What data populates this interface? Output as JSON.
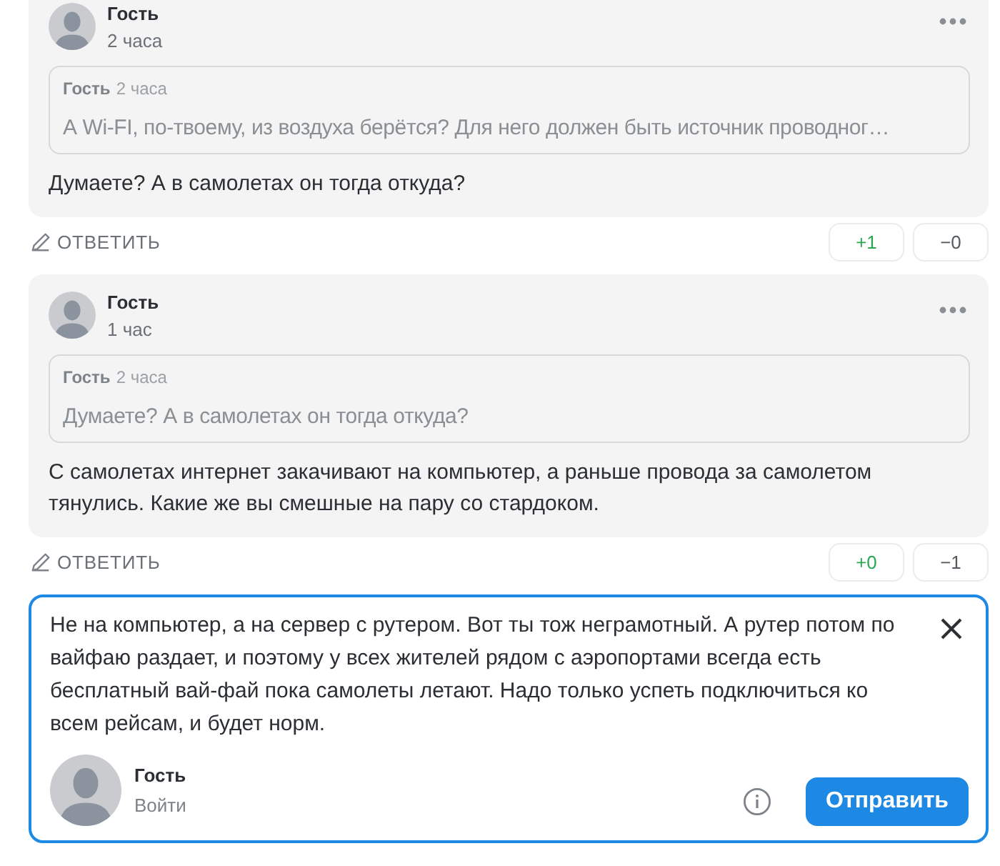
{
  "comments": [
    {
      "author": "Гость",
      "time": "2 часа",
      "quote": {
        "author": "Гость",
        "time": "2 часа",
        "text": "А Wi-FI, по-твоему, из воздуха берётся? Для него должен быть источник проводног…"
      },
      "text": "Думаете? А в самолетах он тогда откуда?",
      "reply": "ОТВЕТИТЬ",
      "upvotes": "+1",
      "downvotes": "−0"
    },
    {
      "author": "Гость",
      "time": "1 час",
      "quote": {
        "author": "Гость",
        "time": "2 часа",
        "text": "Думаете? А в самолетах он тогда откуда?"
      },
      "text": "С самолетах интернет закачивают на компьютер, а раньше провода за самолетом тянулись. Какие же вы смешные на пару со стардоком.",
      "reply": "ОТВЕТИТЬ",
      "upvotes": "+0",
      "downvotes": "−1"
    }
  ],
  "composer": {
    "value": "Не на компьютер, а на сервер с рутером. Вот ты тож неграмотный. А рутер потом по вайфаю раздает, и поэтому у всех жителей рядом с аэропортами всегда есть бесплатный вай-фай пока самолеты летают. Надо только успеть подключиться ко всем рейсам, и будет норм.",
    "author": "Гость",
    "login": "Войти",
    "submit": "Отправить"
  }
}
